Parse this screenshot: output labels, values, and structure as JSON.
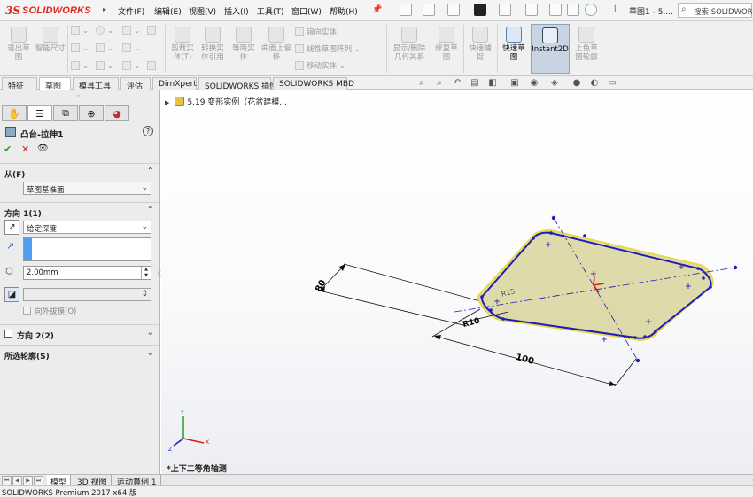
{
  "app": {
    "logo_prefix": "3S",
    "logo_word": "SOLIDWORKS",
    "menus": [
      "文件(F)",
      "编辑(E)",
      "视图(V)",
      "插入(I)",
      "工具(T)",
      "窗口(W)",
      "帮助(H)"
    ],
    "doc_title": "草图1 - 5....",
    "search_placeholder": "搜索 SOLIDWORKS"
  },
  "ribbon": {
    "exit_sketch": "退出草图",
    "smart_dim": "智能尺寸",
    "trim": "剪裁实体(T)",
    "convert": "转换实体引用",
    "offset": "等距实体",
    "surface_offset": "曲面上偏移",
    "mirror": "镜向实体",
    "linear_pattern": "线性草图阵列",
    "move": "移动实体",
    "display_relations": "显示/删除几何关系",
    "repair": "修复草图",
    "quick_snaps": "快速捕捉",
    "rapid_sketch": "快速草图",
    "instant2d": "Instant2D",
    "shaded_contours": "上色草图轮廓"
  },
  "command_tabs": [
    "特征",
    "草图",
    "模具工具",
    "评估",
    "DimXpert",
    "SOLIDWORKS 插件",
    "SOLIDWORKS MBD"
  ],
  "active_tab": "草图",
  "property_manager": {
    "feature_name": "凸台-拉伸1",
    "help": "?",
    "ok": "✔",
    "cancel": "✕",
    "preview": "👁",
    "from": {
      "header": "从(F)",
      "value": "草图基准面"
    },
    "direction1": {
      "header": "方向 1(1)",
      "end_condition": "给定深度",
      "depth": "2.00mm",
      "draft_label": "向外拔模(O)"
    },
    "direction2": {
      "header": "方向 2(2)"
    },
    "selected_contours": {
      "header": "所选轮廓(S)"
    }
  },
  "viewport": {
    "tree_item": "5.19 变形实例（花盆建模...",
    "view_name": "*上下二等角轴测",
    "dimensions": {
      "length": "100",
      "width": "80",
      "r_big": "R15",
      "r_small": "R10"
    }
  },
  "bottom_tabs": [
    "模型",
    "3D 视图",
    "运动算例 1"
  ],
  "status": "SOLIDWORKS Premium 2017 x64 版",
  "colors": {
    "sketch_fill": "#d9d49a",
    "sketch_outline": "#1e1eb4",
    "preview_edge": "#e8d84a",
    "dim_line": "#111111",
    "accent_red": "#e2231a"
  }
}
